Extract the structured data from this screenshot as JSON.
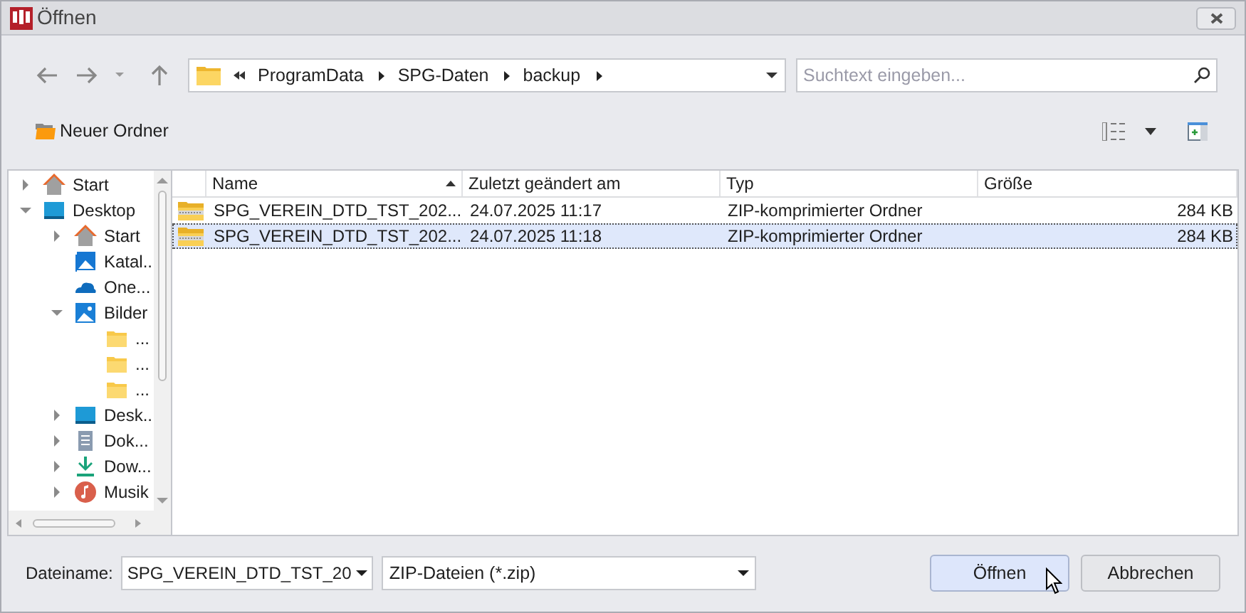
{
  "window": {
    "title": "Öffnen"
  },
  "breadcrumb": [
    "ProgramData",
    "SPG-Daten",
    "backup"
  ],
  "search": {
    "placeholder": "Suchtext eingeben..."
  },
  "toolbar": {
    "new_folder": "Neuer Ordner"
  },
  "tree": [
    {
      "label": "Start",
      "kind": "home",
      "expanded": false
    },
    {
      "label": "Desktop",
      "kind": "desktop",
      "expanded": true,
      "children": [
        {
          "label": "Start",
          "kind": "home",
          "expanded": false
        },
        {
          "label": "Katal..",
          "kind": "gallery"
        },
        {
          "label": "One...",
          "kind": "cloud"
        },
        {
          "label": "Bilder",
          "kind": "pictures",
          "expanded": true,
          "children": [
            {
              "label": "...",
              "kind": "folder"
            },
            {
              "label": "...",
              "kind": "folder"
            },
            {
              "label": "...",
              "kind": "folder"
            }
          ]
        },
        {
          "label": "Desk..",
          "kind": "desktop",
          "expanded": false
        },
        {
          "label": "Dok...",
          "kind": "document",
          "expanded": false
        },
        {
          "label": "Dow...",
          "kind": "download",
          "expanded": false
        },
        {
          "label": "Musik",
          "kind": "music",
          "expanded": false
        }
      ]
    }
  ],
  "table": {
    "columns": [
      "Name",
      "Zuletzt geändert am",
      "Typ",
      "Größe"
    ],
    "rows": [
      {
        "name": "SPG_VEREIN_DTD_TST_202...",
        "modified": "24.07.2025 11:17",
        "type": "ZIP-komprimierter Ordner",
        "size": "284 KB",
        "selected": false
      },
      {
        "name": "SPG_VEREIN_DTD_TST_202...",
        "modified": "24.07.2025 11:18",
        "type": "ZIP-komprimierter Ordner",
        "size": "284 KB",
        "selected": true
      }
    ]
  },
  "footer": {
    "filename_label": "Dateiname:",
    "filename": "SPG_VEREIN_DTD_TST_20",
    "filter": "ZIP-Dateien (*.zip)",
    "buttons": [
      "Öffnen",
      "Abbrechen"
    ]
  }
}
